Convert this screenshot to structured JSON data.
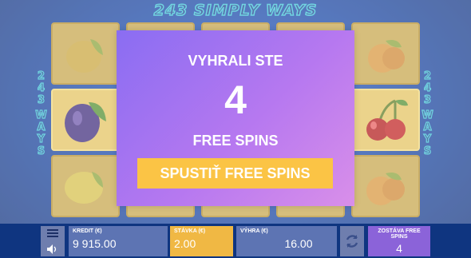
{
  "game": {
    "title": "243 SIMPLY WAYS",
    "side_label_number": "243",
    "side_label_word": "WAYS"
  },
  "reels": [
    [
      "lemon-icon",
      "plum-icon",
      "lemon-icon"
    ],
    [
      "blank",
      "blank",
      "blank"
    ],
    [
      "blank",
      "blank",
      "blank"
    ],
    [
      "blank",
      "blank",
      "blank"
    ],
    [
      "orange-icon",
      "cherry-icon",
      "orange-icon"
    ]
  ],
  "modal": {
    "title": "VYHRALI STE",
    "count": "4",
    "subtitle": "FREE SPINS",
    "button_label": "SPUSTIŤ FREE SPINS"
  },
  "footer": {
    "kredit_label": "KREDIT (€)",
    "kredit_value": "9 915.00",
    "stavka_label": "STÁVKA (€)",
    "stavka_value": "2.00",
    "vyhra_label": "VÝHRA (€)",
    "vyhra_value": "16.00",
    "free_spins_label": "ZOSTÁVA FREE SPINS",
    "free_spins_value": "4"
  },
  "colors": {
    "modal_button": "#fbc445",
    "modal_gradient_start": "#8a6df2",
    "modal_gradient_end": "#d98fe9",
    "panel": "#5d74b3",
    "bet_panel": "#f0b844",
    "free_spins_panel": "#8b63d9"
  }
}
